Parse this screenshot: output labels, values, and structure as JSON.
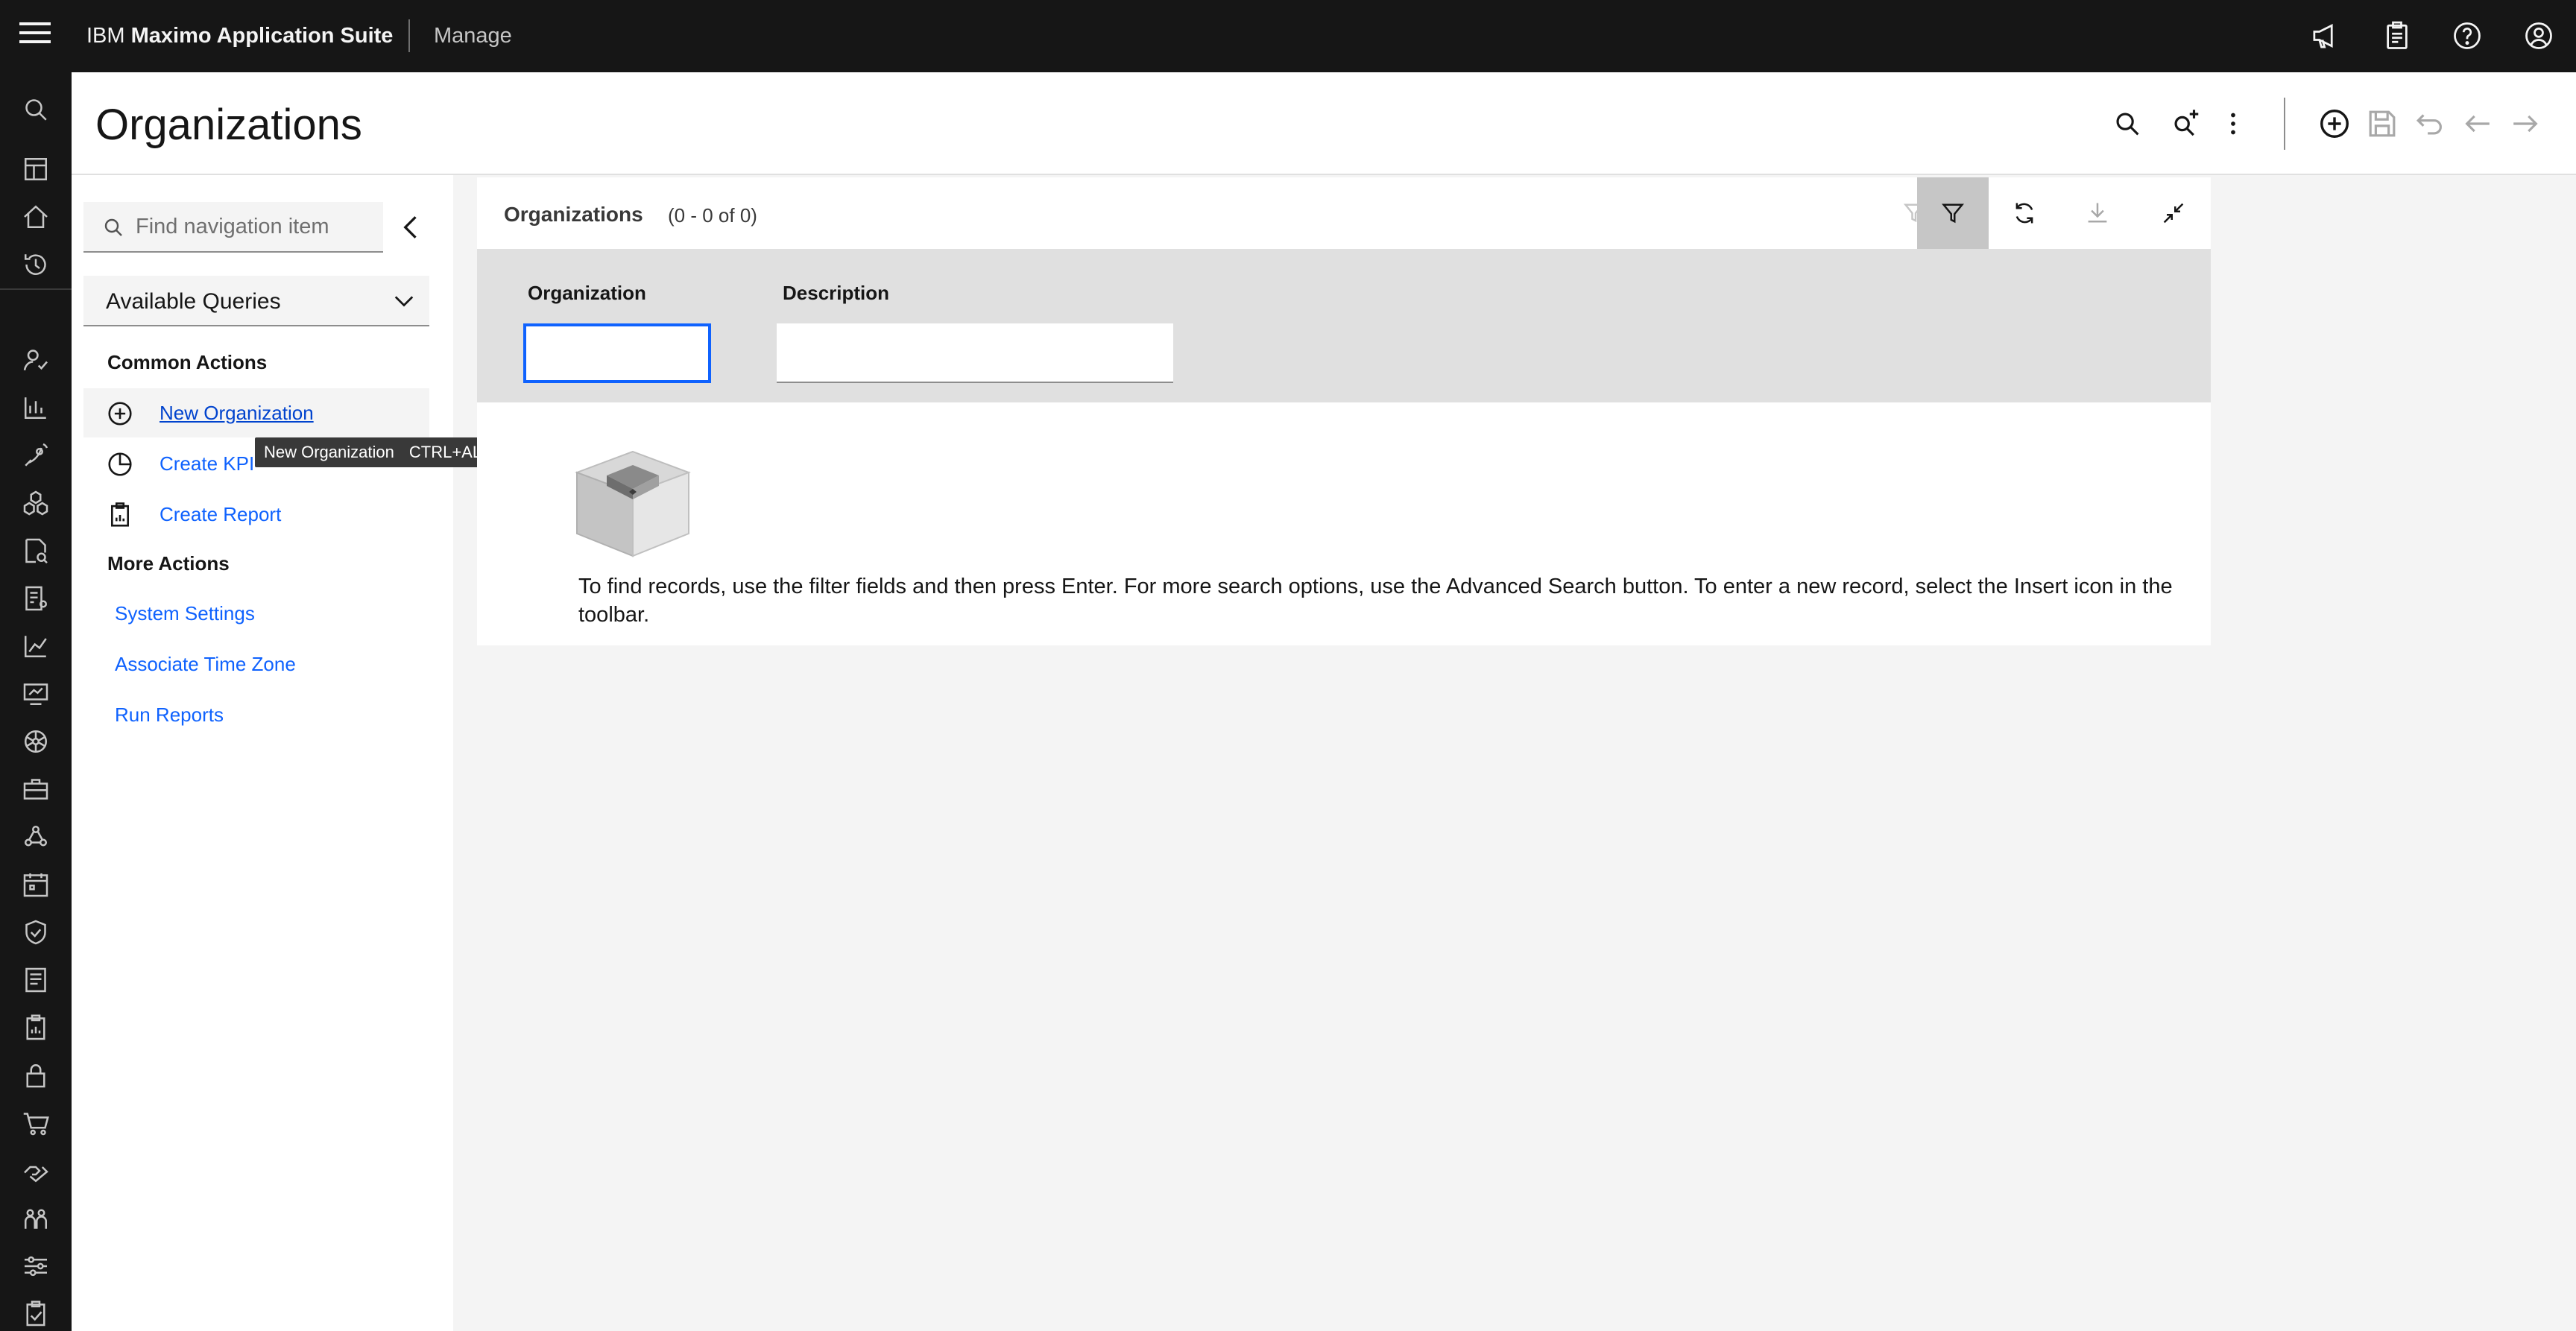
{
  "topbar": {
    "brand_prefix": "IBM",
    "brand_name": "Maximo Application Suite",
    "app_name": "Manage",
    "icons": [
      "menu-icon",
      "announcement-icon",
      "clipboard-icon",
      "help-icon",
      "user-avatar-icon"
    ]
  },
  "rail": {
    "icons": [
      "search-icon",
      "dashboard-icon",
      "home-icon",
      "recent-icon",
      "work-icon",
      "analytics-icon",
      "satellite-icon",
      "assets-icon",
      "inspection-icon",
      "inventory-icon",
      "chart-icon",
      "monitor-icon",
      "settings-wheel-icon",
      "tools-icon",
      "network-icon",
      "planning-icon",
      "safety-icon",
      "contracts-icon",
      "reports-icon",
      "security-icon",
      "purchasing-icon",
      "service-icon",
      "people-icon",
      "configuration-icon",
      "checklist-icon"
    ]
  },
  "header": {
    "title": "Organizations",
    "icons": [
      "search-icon",
      "advanced-search-icon",
      "overflow-menu-icon",
      "add-icon",
      "save-icon",
      "undo-icon",
      "previous-icon",
      "next-icon"
    ]
  },
  "nav": {
    "search_placeholder": "Find navigation item",
    "queries_label": "Available Queries",
    "common_actions_heading": "Common Actions",
    "common_actions": [
      {
        "label": "New Organization",
        "icon": "add-circle-icon"
      },
      {
        "label": "Create KPI",
        "icon": "pie-chart-icon"
      },
      {
        "label": "Create Report",
        "icon": "report-icon"
      }
    ],
    "more_actions_heading": "More Actions",
    "more_actions": [
      "System Settings",
      "Associate Time Zone",
      "Run Reports"
    ],
    "tooltip": {
      "label": "New Organization",
      "shortcut": "CTRL+ALT+I"
    }
  },
  "table": {
    "title": "Organizations",
    "count": "(0 - 0 of 0)",
    "toolbar_icons": [
      "clear-filter-icon",
      "filter-icon",
      "refresh-icon",
      "download-icon",
      "collapse-icon"
    ],
    "columns": [
      "Organization",
      "Description"
    ],
    "filter_values": [
      "",
      ""
    ],
    "empty_message": "To find records, use the filter fields and then press Enter. For more search options, use the Advanced Search button. To enter a new record, select the Insert icon in the toolbar."
  },
  "colors": {
    "topbar_bg": "#161616",
    "link": "#0f62fe",
    "focus": "#0f62fe",
    "filter_row_bg": "#e0e0e0",
    "page_bg": "#f4f4f4"
  }
}
